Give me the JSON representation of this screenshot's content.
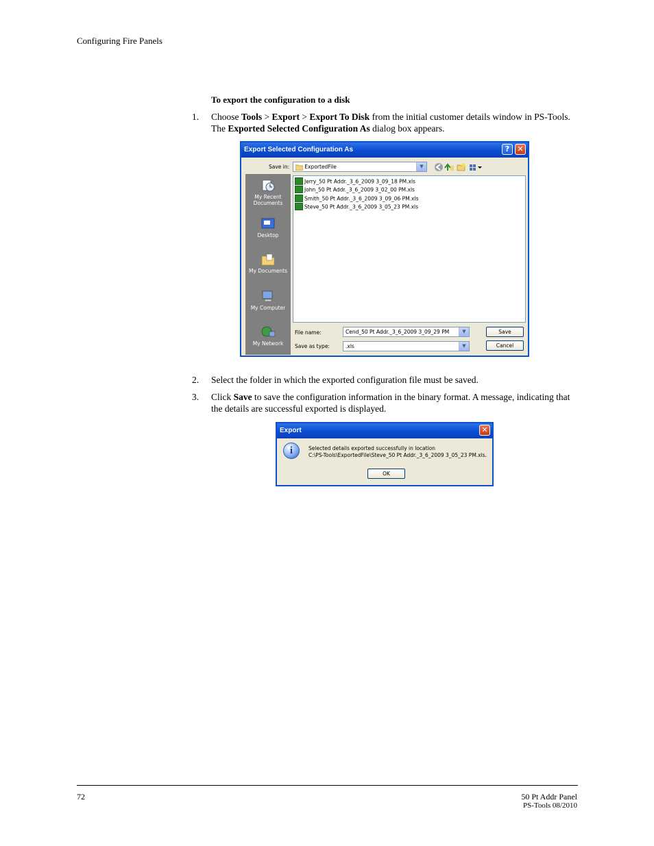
{
  "header": {
    "running_title": "Configuring Fire Panels"
  },
  "section": {
    "heading": "To export the configuration to a disk"
  },
  "steps": [
    {
      "number": "1.",
      "parts": [
        "Choose ",
        "Tools",
        " > ",
        "Export",
        " > ",
        "Export To Disk",
        " from the initial customer details window in PS-Tools. The ",
        "Exported Selected Configuration As",
        " dialog box appears."
      ]
    },
    {
      "number": "2.",
      "text": "Select the folder in which the exported configuration file must be saved."
    },
    {
      "number": "3.",
      "parts": [
        "Click ",
        "Save",
        " to save the configuration information in the binary format. A message, indicating that the details are successful exported is displayed."
      ]
    }
  ],
  "save_dialog": {
    "title": "Export Selected Configuration As",
    "save_in_label": "Save in:",
    "save_in_value": "ExportedFile",
    "places": [
      "My Recent Documents",
      "Desktop",
      "My Documents",
      "My Computer",
      "My Network"
    ],
    "files": [
      "Jerry_50 Pt Addr._3_6_2009 3_09_18 PM.xls",
      "John_50 Pt Addr._3_6_2009 3_02_00 PM.xls",
      "Smith_50 Pt Addr._3_6_2009 3_09_06 PM.xls",
      "Steve_50 Pt Addr._3_6_2009 3_05_23 PM.xls"
    ],
    "file_name_label": "File name:",
    "file_name_value": "Cend_50 Pt Addr._3_6_2009 3_09_29 PM",
    "save_type_label": "Save as type:",
    "save_type_value": ".xls",
    "save_button": "Save",
    "cancel_button": "Cancel",
    "help_glyph": "?",
    "close_glyph": "✕"
  },
  "export_dialog": {
    "title": "Export",
    "message_line1": "Selected details exported successfully in location",
    "message_line2": "C:\\PS-Tools\\ExportedFile\\Steve_50 Pt Addr._3_6_2009 3_05_23 PM.xls.",
    "ok_button": "OK",
    "info_glyph": "i",
    "close_glyph": "✕"
  },
  "footer": {
    "page_number": "72",
    "product": "50 Pt Addr Panel",
    "version": "PS-Tools 08/2010"
  }
}
